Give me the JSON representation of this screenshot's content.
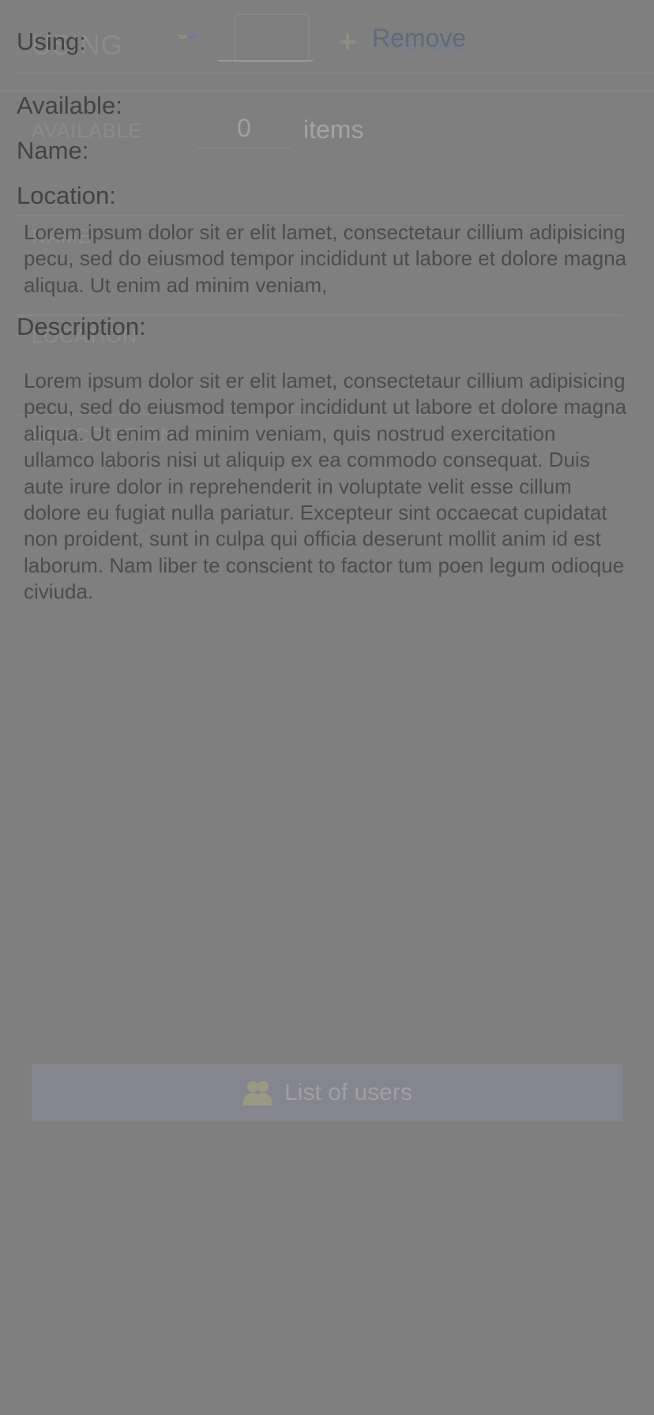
{
  "under": {
    "using_label": "USING",
    "available_label": "AVAILABLE",
    "available_value": "0",
    "items_unit": "items",
    "name_label": "NAME",
    "location_label": "LOCATION",
    "description_label": "DESCRIPTION",
    "remove_label": "Remove",
    "users_button_label": "List of users"
  },
  "overlay": {
    "using_label": "Using:",
    "remove_label": "Remove",
    "available_label": "Available:",
    "name_label": "Name:",
    "location_label": "Location:",
    "location_text": "Lorem ipsum dolor sit er elit lamet, consectetaur cillium adipisicing pecu, sed do eiusmod tempor incididunt ut labore et dolore magna aliqua. Ut enim ad minim veniam,",
    "description_label": "Description:",
    "description_text": "Lorem ipsum dolor sit er elit lamet, consectetaur cillium adipisicing pecu, sed do eiusmod tempor incididunt ut labore et dolore magna aliqua. Ut enim ad minim veniam, quis nostrud exercitation ullamco laboris nisi ut aliquip ex ea commodo consequat. Duis aute irure dolor in reprehenderit in voluptate velit esse cillum dolore eu fugiat nulla pariatur. Excepteur sint occaecat cupidatat non proident, sunt in culpa qui officia deserunt mollit anim id est laborum. Nam liber te conscient to factor tum poen legum odioque civiuda."
  },
  "colors": {
    "background": "#7f7f7f",
    "overlay_text": "#434343",
    "link": "#616a79",
    "users_button_bg": "#858590"
  },
  "icons": [
    "minus-icon",
    "plus-icon",
    "users-icon"
  ]
}
